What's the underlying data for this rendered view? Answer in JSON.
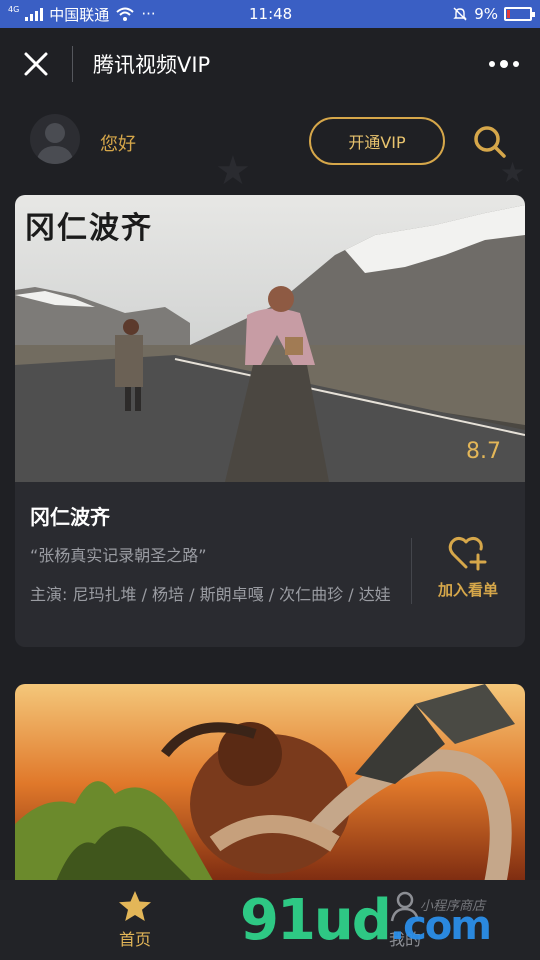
{
  "status_bar": {
    "net": "4G",
    "carrier": "中国联通",
    "extras": "···",
    "time": "11:48",
    "battery": "9%",
    "battery_level": 0.09
  },
  "nav": {
    "close_icon": "close-icon",
    "title": "腾讯视频VIP",
    "more_icon": "more-dots-icon"
  },
  "header": {
    "greeting": "您好",
    "vip_button": "开通VIP",
    "search_icon": "search-icon"
  },
  "cards": [
    {
      "poster_title_art": "冈仁波齐",
      "rating": "8.7",
      "title": "冈仁波齐",
      "tagline": "“张杨真实记录朝圣之路”",
      "cast": "主演: 尼玛扎堆 / 杨培 / 斯朗卓嘎 / 次仁曲珍 / 达娃",
      "add_label": "加入看单",
      "add_icon": "heart-plus-icon"
    },
    {
      "poster": "kong-poster-image"
    }
  ],
  "tabbar": {
    "home": {
      "label": "首页",
      "icon": "star-icon"
    },
    "mine": {
      "label": "我的",
      "icon": "user-icon"
    }
  },
  "watermark": {
    "text": "91ud",
    "suffix": ".com",
    "small_text": "小程序商店"
  },
  "colors": {
    "background": "#1f2024",
    "accent_gold": "#d6a74a",
    "status_bar": "#3a5fc4",
    "card": "#2a2b30"
  }
}
